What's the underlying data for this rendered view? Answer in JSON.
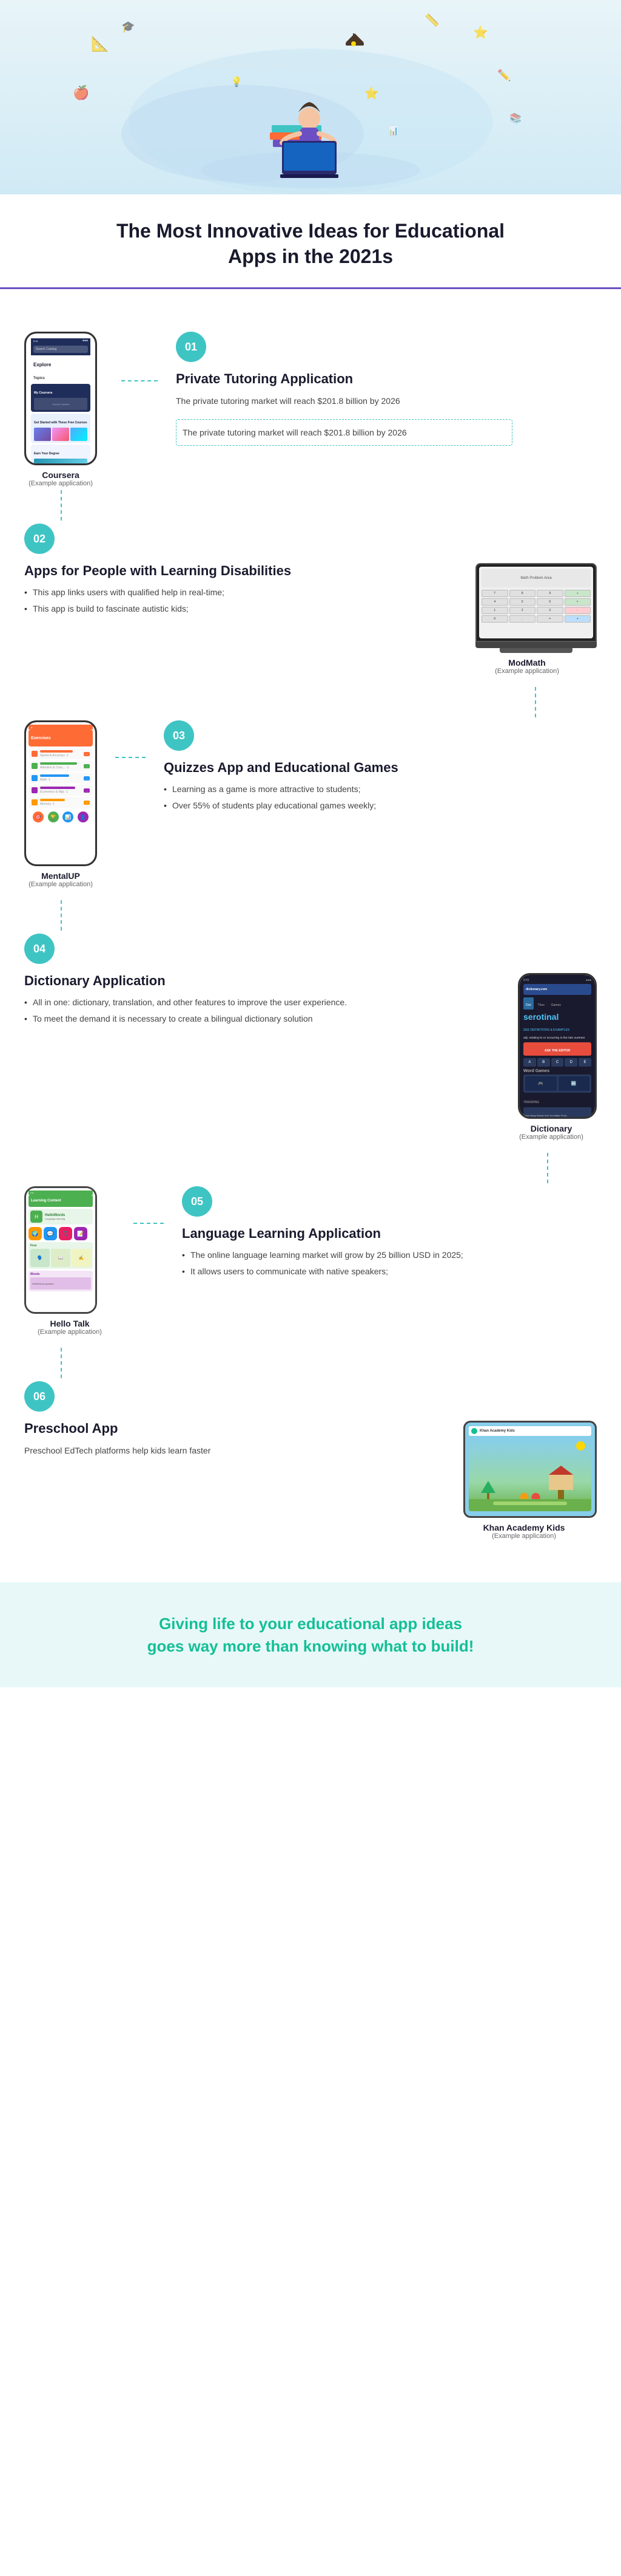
{
  "hero": {
    "alt": "Student studying with laptop illustration"
  },
  "title_section": {
    "line1": "The Most Innovative Ideas for Educational",
    "line2": "Apps in the 2021s"
  },
  "sections": [
    {
      "num": "01",
      "title": "Private Tutoring Application",
      "desc": "The private tutoring market will reach $201.8 billion by 2026",
      "list": [],
      "app_name": "Coursera",
      "app_sub": "(Example application)",
      "side": "right"
    },
    {
      "num": "02",
      "title": "Apps for People with Learning Disabilities",
      "desc": "",
      "list": [
        "This app links users with qualified help in real-time;",
        "This app is build to fascinate autistic kids;"
      ],
      "app_name": "ModMath",
      "app_sub": "(Example application)",
      "side": "left"
    },
    {
      "num": "03",
      "title": "Quizzes App and Educational Games",
      "desc": "",
      "list": [
        "Learning as a game is more attractive to students;",
        "Over 55% of students play educational games weekly;"
      ],
      "app_name": "MentalUP",
      "app_sub": "(Example application)",
      "side": "right"
    },
    {
      "num": "04",
      "title": "Dictionary Application",
      "desc": "",
      "list": [
        "All in one: dictionary, translation, and other features to improve the user experience.",
        "To meet the demand it is necessary to create a bilingual dictionary solution"
      ],
      "app_name": "Dictionary",
      "app_sub": "(Example application)",
      "side": "left"
    },
    {
      "num": "05",
      "title": "Language Learning Application",
      "desc": "",
      "list": [
        "The online language learning market will grow by 25 billion USD in 2025;",
        "It allows users to communicate with native speakers;"
      ],
      "app_name": "Hello Talk",
      "app_sub": "(Example application)",
      "side": "right"
    },
    {
      "num": "06",
      "title": "Preschool App",
      "desc": "Preschool EdTech platforms help kids learn faster",
      "list": [],
      "app_name": "Khan Academy Kids",
      "app_sub": "(Example application)",
      "side": "left"
    }
  ],
  "coursera": {
    "header_text": "Explore",
    "topics_label": "Topics",
    "card1_text": "My Coursera",
    "card2_text": "Get Started with These Free Courses",
    "card3_text": "Earn Your Degree"
  },
  "modmath": {
    "label": "ModMath"
  },
  "mentalup": {
    "header": "Exercises",
    "items": [
      {
        "color": "#ff6b35",
        "text": "Speed & Accuracy -1"
      },
      {
        "color": "#4caf50",
        "text": "Attention & Concentration -1"
      },
      {
        "color": "#2196f3",
        "text": "Math -1"
      },
      {
        "color": "#9c27b0",
        "text": "Economics & Mgt. -1"
      },
      {
        "color": "#ff9800",
        "text": "Memory -1"
      }
    ]
  },
  "dictionary": {
    "site_label": "dictionary.com",
    "word": "serotinal",
    "def_label": "SEE DEFINITIONS & EXAMPLES",
    "btn_label": "ASK THE EDITOR",
    "word_games_label": "Word Games",
    "trending_label": "TRENDING"
  },
  "hellotalk": {
    "header": "Learning Content",
    "brand": "HelloWords",
    "free_label": "Free",
    "words_label": "Words"
  },
  "khan": {
    "header": "Khan Academy Kids",
    "scene": "Game scene with house"
  },
  "cta": {
    "line1": "Giving life to your educational app ideas",
    "line2": "goes way more than knowing what to build!"
  }
}
